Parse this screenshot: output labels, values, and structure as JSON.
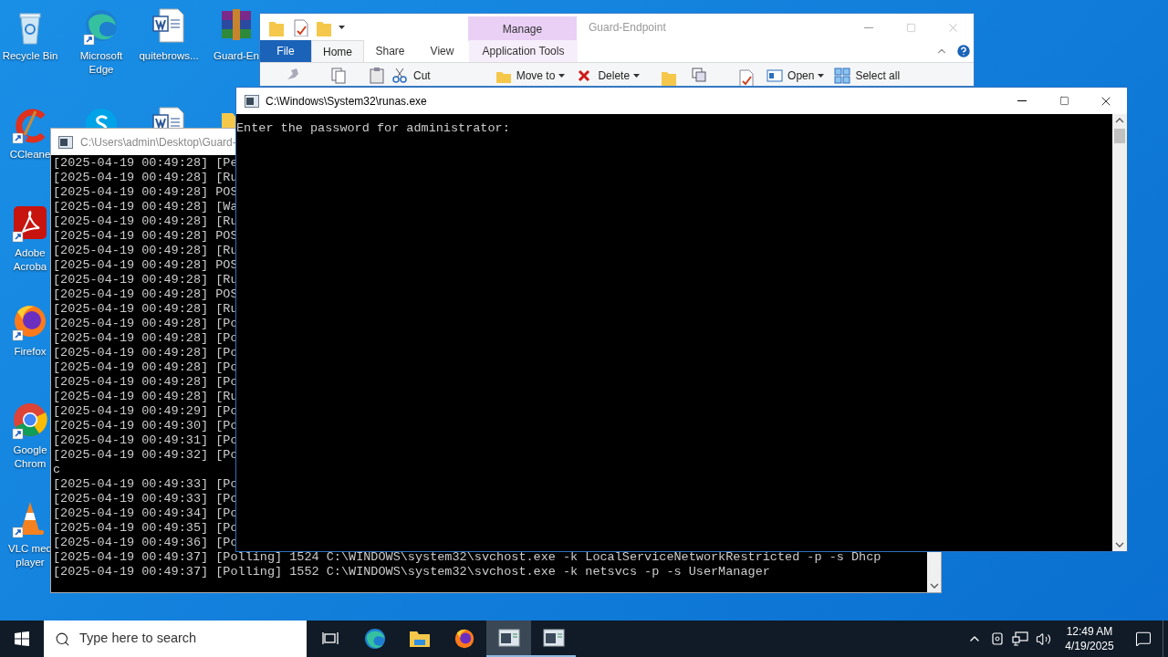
{
  "desktop_columns": [
    {
      "icons": [
        {
          "kind": "recycle",
          "label": "Recycle Bin"
        },
        {
          "kind": "ccleaner",
          "label": "CCleane"
        },
        {
          "kind": "acrobat",
          "label": "Adobe\nAcroba"
        },
        {
          "kind": "firefox",
          "label": "Firefox"
        },
        {
          "kind": "chrome",
          "label": "Google\nChrom"
        },
        {
          "kind": "vlc",
          "label": "VLC med\nplayer"
        }
      ]
    },
    {
      "icons": [
        {
          "kind": "edge",
          "label": "Microsoft\nEdge"
        },
        {
          "kind": "skype"
        }
      ]
    },
    {
      "icons": [
        {
          "kind": "word",
          "label": "quitebrows..."
        },
        {
          "kind": "word"
        }
      ]
    },
    {
      "icons": [
        {
          "kind": "winrar",
          "label": "Guard-En"
        },
        {
          "kind": "folder"
        }
      ]
    }
  ],
  "explorer": {
    "context_tab": "Manage",
    "title": "Guard-Endpoint",
    "tabs": [
      {
        "label": "File",
        "kind": "file",
        "selected": false
      },
      {
        "label": "Home",
        "kind": "tab",
        "selected": true
      },
      {
        "label": "Share",
        "kind": "tab",
        "selected": false
      },
      {
        "label": "View",
        "kind": "tab",
        "selected": false
      },
      {
        "label": "Application Tools",
        "kind": "context",
        "selected": false
      }
    ],
    "ribbon": [
      {
        "kind": "paste"
      },
      {
        "kind": "copy"
      },
      {
        "kind": "clipboard"
      },
      {
        "kind": "cut",
        "label": "Cut"
      },
      {
        "kind": "move",
        "label": "Move to",
        "dropdown": true
      },
      {
        "kind": "delete",
        "label": "Delete",
        "dropdown": true
      },
      {
        "kind": "folder"
      },
      {
        "kind": "copy2"
      },
      {
        "kind": "properties"
      },
      {
        "kind": "open",
        "label": "Open",
        "dropdown": true
      },
      {
        "kind": "select",
        "label": "Select all"
      }
    ]
  },
  "console": {
    "title": "C:\\Users\\admin\\Desktop\\Guard-",
    "lines": [
      "[2025-04-19 00:49:28] [Pe",
      "[2025-04-19 00:49:28] [Ru",
      "[2025-04-19 00:49:28] POS",
      "[2025-04-19 00:49:28] [Wa",
      "[2025-04-19 00:49:28] [Ru",
      "[2025-04-19 00:49:28] POS",
      "[2025-04-19 00:49:28] [Ru",
      "[2025-04-19 00:49:28] POS",
      "[2025-04-19 00:49:28] [Ru",
      "[2025-04-19 00:49:28] POS",
      "[2025-04-19 00:49:28] [Ru",
      "[2025-04-19 00:49:28] [Po",
      "[2025-04-19 00:49:28] [Po",
      "[2025-04-19 00:49:28] [Po",
      "[2025-04-19 00:49:28] [Po",
      "[2025-04-19 00:49:28] [Po",
      "[2025-04-19 00:49:28] [Ru",
      "[2025-04-19 00:49:29] [Po",
      "[2025-04-19 00:49:30] [Po",
      "[2025-04-19 00:49:31] [Po",
      "[2025-04-19 00:49:32] [Po",
      "c",
      "[2025-04-19 00:49:33] [Po",
      "[2025-04-19 00:49:33] [Po",
      "[2025-04-19 00:49:34] [Po",
      "[2025-04-19 00:49:35] [Po",
      "[2025-04-19 00:49:36] [Po",
      "[2025-04-19 00:49:37] [Polling] 1524 C:\\WINDOWS\\system32\\svchost.exe -k LocalServiceNetworkRestricted -p -s Dhcp",
      "[2025-04-19 00:49:37] [Polling] 1552 C:\\WINDOWS\\system32\\svchost.exe -k netsvcs -p -s UserManager"
    ]
  },
  "runas": {
    "title": "C:\\Windows\\System32\\runas.exe",
    "prompt": "Enter the password for administrator:"
  },
  "taskbar": {
    "search": {
      "placeholder": "Type here to search"
    },
    "apps": [
      {
        "kind": "taskview",
        "selected": false
      },
      {
        "kind": "edge",
        "selected": false
      },
      {
        "kind": "explorer",
        "selected": false
      },
      {
        "kind": "firefox",
        "selected": false
      },
      {
        "kind": "console",
        "selected": true
      },
      {
        "kind": "console",
        "selected": false
      }
    ],
    "time": "12:49 AM",
    "date": "4/19/2025"
  }
}
